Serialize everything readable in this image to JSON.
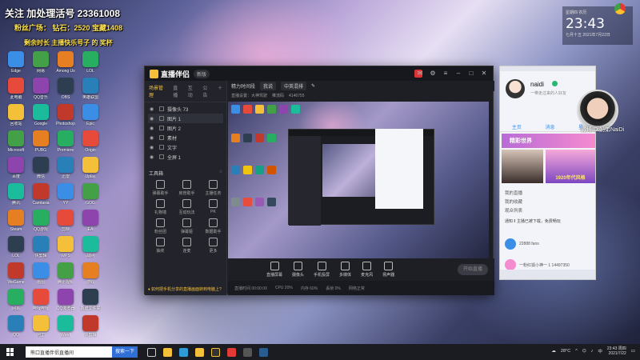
{
  "desktop": {
    "overlay_line1": "关注 加处理活号 23361008",
    "overlay_line2": "粉丝广场：  钻石：2520 宝藏1408",
    "overlay_line3": "剩余时长  主播快乐号子 的 奖杯",
    "icons_col1": [
      "Edge",
      "此电脑",
      "回收站",
      "Microsoft",
      "百度",
      "腾讯",
      "Steam",
      "LOL",
      "WeGame",
      "网易",
      "QQ"
    ],
    "icons_col2": [
      "网易",
      "QQ音乐",
      "Google",
      "PUBG",
      "微信",
      "Camtasia",
      "QQ游戏",
      "快剪辑",
      "画图",
      "哔哩哔哩",
      "阿里"
    ],
    "icons_col3": [
      "Among Us",
      "OBS",
      "Photoshop",
      "Premiere",
      "迅雷",
      "YY",
      "剪映",
      "WPS",
      "腾讯视频",
      "QQ浏览器",
      "Word"
    ],
    "icons_col4": [
      "LOL",
      "英雄联盟",
      "Epic",
      "Origin",
      "Uplay",
      "GOG",
      "EA",
      "战网",
      "游戏",
      "新建文件夹",
      "快剪辑"
    ]
  },
  "clock": {
    "label_top": "星期四 农历",
    "time": "23:43",
    "date": "七月十五  2021年7月22日"
  },
  "app": {
    "logo_text": "直播伴侣",
    "version": "新版",
    "tabs": [
      "场景管理",
      "直播",
      "互动",
      "公告"
    ],
    "scenes": [
      {
        "label": "摄像头 73",
        "selected": false
      },
      {
        "label": "图片 1",
        "selected": true
      },
      {
        "label": "图片 2",
        "selected": false
      },
      {
        "label": "素材",
        "selected": false
      },
      {
        "label": "文字",
        "selected": false
      },
      {
        "label": "全屏 1",
        "selected": false
      }
    ],
    "tools_title": "工具箱",
    "tools": [
      "弹幕助手",
      "房管助手",
      "主播任务",
      "礼物墙",
      "互动玩法",
      "PK",
      "粉丝团",
      "弹幕姬",
      "数据助手",
      "抽奖",
      "连麦",
      "更多"
    ],
    "footer_tip": "♦ 如何把手机分享的直播画面转到电脑上?",
    "top_title": "精力时间段",
    "top_pill": "我说",
    "top_field": "中英混排",
    "sub_items": [
      "直播设置：大神驾驶",
      "推流码",
      "4146755"
    ],
    "bottom_tools": [
      "直播屏幕",
      "摄像头",
      "手机投屏",
      "多媒体",
      "麦克风",
      "扬声器"
    ],
    "start_button": "开始直播",
    "status": [
      "直播时间 00:00:00",
      "CPU 20%",
      "内存 60%",
      "丢帧 0%",
      "网络正常"
    ]
  },
  "social": {
    "name": "naidi",
    "signature": "一带走过来的人好友",
    "tabs": [
      "主页",
      "消息",
      "星"
    ],
    "banner": "精彩世界",
    "card_text": "1920年代风格",
    "list": [
      "我的直播",
      "我的收藏",
      "观众列表"
    ],
    "notice": "通知 ‖ 主播已被下载，免费畅玩",
    "items": [
      {
        "text": "22888 fans"
      },
      {
        "text": "一粉红狐小神一  1 14497350"
      }
    ]
  },
  "webcam": {
    "label": "微博ID:奶弟NaiDi"
  },
  "taskbar": {
    "search_text": "熊口直播伴侣直播间",
    "search_button": "搜索一下",
    "tray_temp": "28°C",
    "tray_time": "23:43 周四",
    "tray_date": "2021/7/22"
  },
  "colors": {
    "accent": "#f4c03a",
    "app_bg": "#1e1f25",
    "social_accent": "#3a8ee6"
  }
}
